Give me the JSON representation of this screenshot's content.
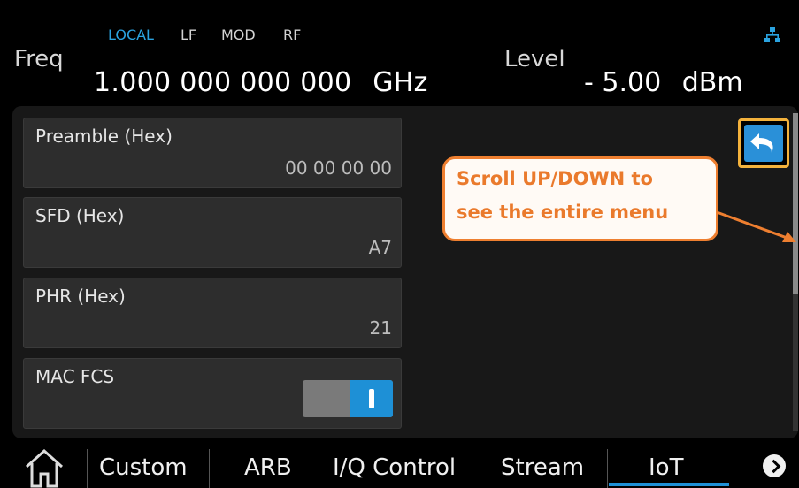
{
  "status": {
    "local": "LOCAL",
    "lf": "LF",
    "mod": "MOD",
    "rf": "RF"
  },
  "freq": {
    "label": "Freq",
    "value": "1.000 000 000 000",
    "unit": "GHz"
  },
  "level": {
    "label": "Level",
    "value": "- 5.00",
    "unit": "dBm"
  },
  "fields": [
    {
      "label": "Preamble (Hex)",
      "value": "00 00 00 00"
    },
    {
      "label": "SFD (Hex)",
      "value": "A7"
    },
    {
      "label": "PHR (Hex)",
      "value": "21"
    },
    {
      "label": "MAC FCS",
      "value": ""
    }
  ],
  "mac_fcs_on": true,
  "callout": {
    "line1": "Scroll UP/DOWN to",
    "line2": "see the entire menu"
  },
  "tabs": [
    "Custom",
    "ARB",
    "I/Q Control",
    "Stream",
    "IoT"
  ],
  "active_tab": "IoT",
  "colors": {
    "accent": "#1e90d6",
    "callout": "#ee7f30",
    "highlight": "#f4b23c"
  },
  "icons": {
    "network": "network-icon",
    "back": "back-arrow-icon",
    "home": "home-icon",
    "next": "chevron-right-icon"
  }
}
